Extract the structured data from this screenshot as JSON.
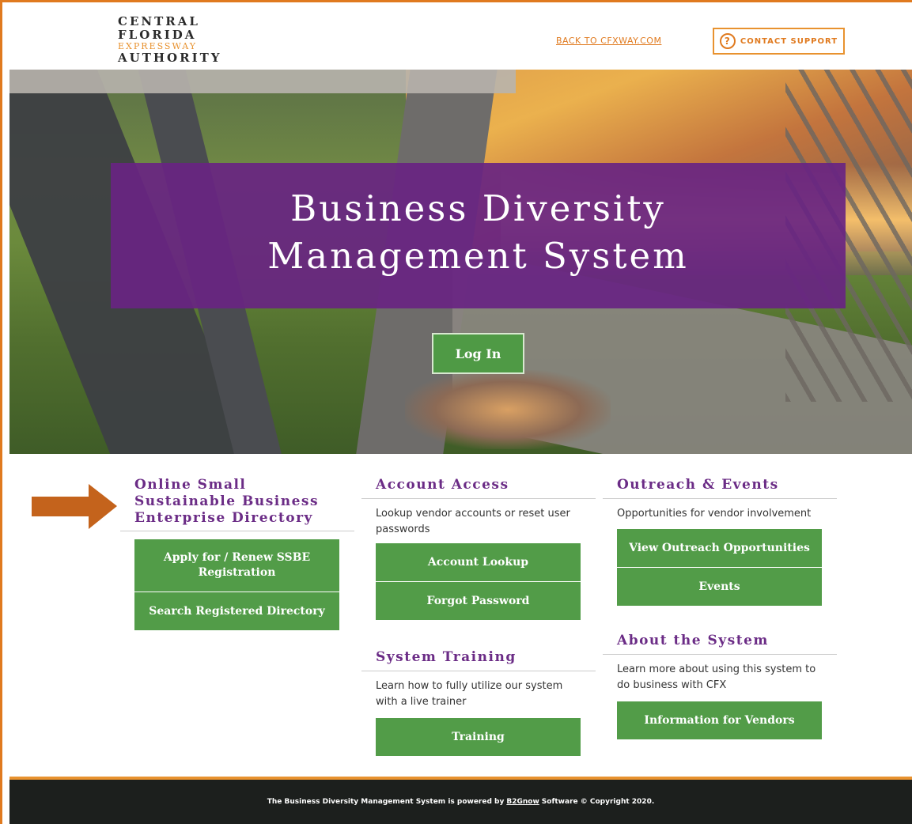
{
  "header": {
    "logo": {
      "line1": "CENTRAL",
      "line2": "FLORIDA",
      "line3": "EXPRESSWAY",
      "line4": "AUTHORITY"
    },
    "back_link": "BACK TO CFXWAY.COM",
    "support_label": "CONTACT SUPPORT",
    "support_icon": "?"
  },
  "hero": {
    "title_line1": "Business Diversity",
    "title_line2": "Management System",
    "login_label": "Log In"
  },
  "sections": {
    "directory": {
      "title_line1": "Online Small",
      "title_line2": "Sustainable Business",
      "title_line3": "Enterprise Directory",
      "buttons": [
        "Apply for / Renew SSBE Registration",
        "Search Registered Directory"
      ]
    },
    "account": {
      "title": "Account Access",
      "desc": "Lookup vendor accounts or reset user passwords",
      "buttons": [
        "Account Lookup",
        "Forgot Password"
      ]
    },
    "training": {
      "title": "System Training",
      "desc": "Learn how to fully utilize our system with a live trainer",
      "buttons": [
        "Training"
      ]
    },
    "outreach": {
      "title": "Outreach & Events",
      "desc": "Opportunities for vendor involvement",
      "buttons": [
        "View Outreach Opportunities",
        "Events"
      ]
    },
    "about": {
      "title": "About the System",
      "desc": "Learn more about using this system to do business with CFX",
      "buttons": [
        "Information for Vendors"
      ]
    }
  },
  "footer": {
    "prefix": "The Business Diversity Management System is powered by",
    "link": "B2Gnow",
    "suffix": "Software © Copyright 2020."
  },
  "colors": {
    "accent_orange": "#e07a1f",
    "purple": "#6b2c86",
    "green": "#529c48",
    "arrow": "#c4631c"
  }
}
